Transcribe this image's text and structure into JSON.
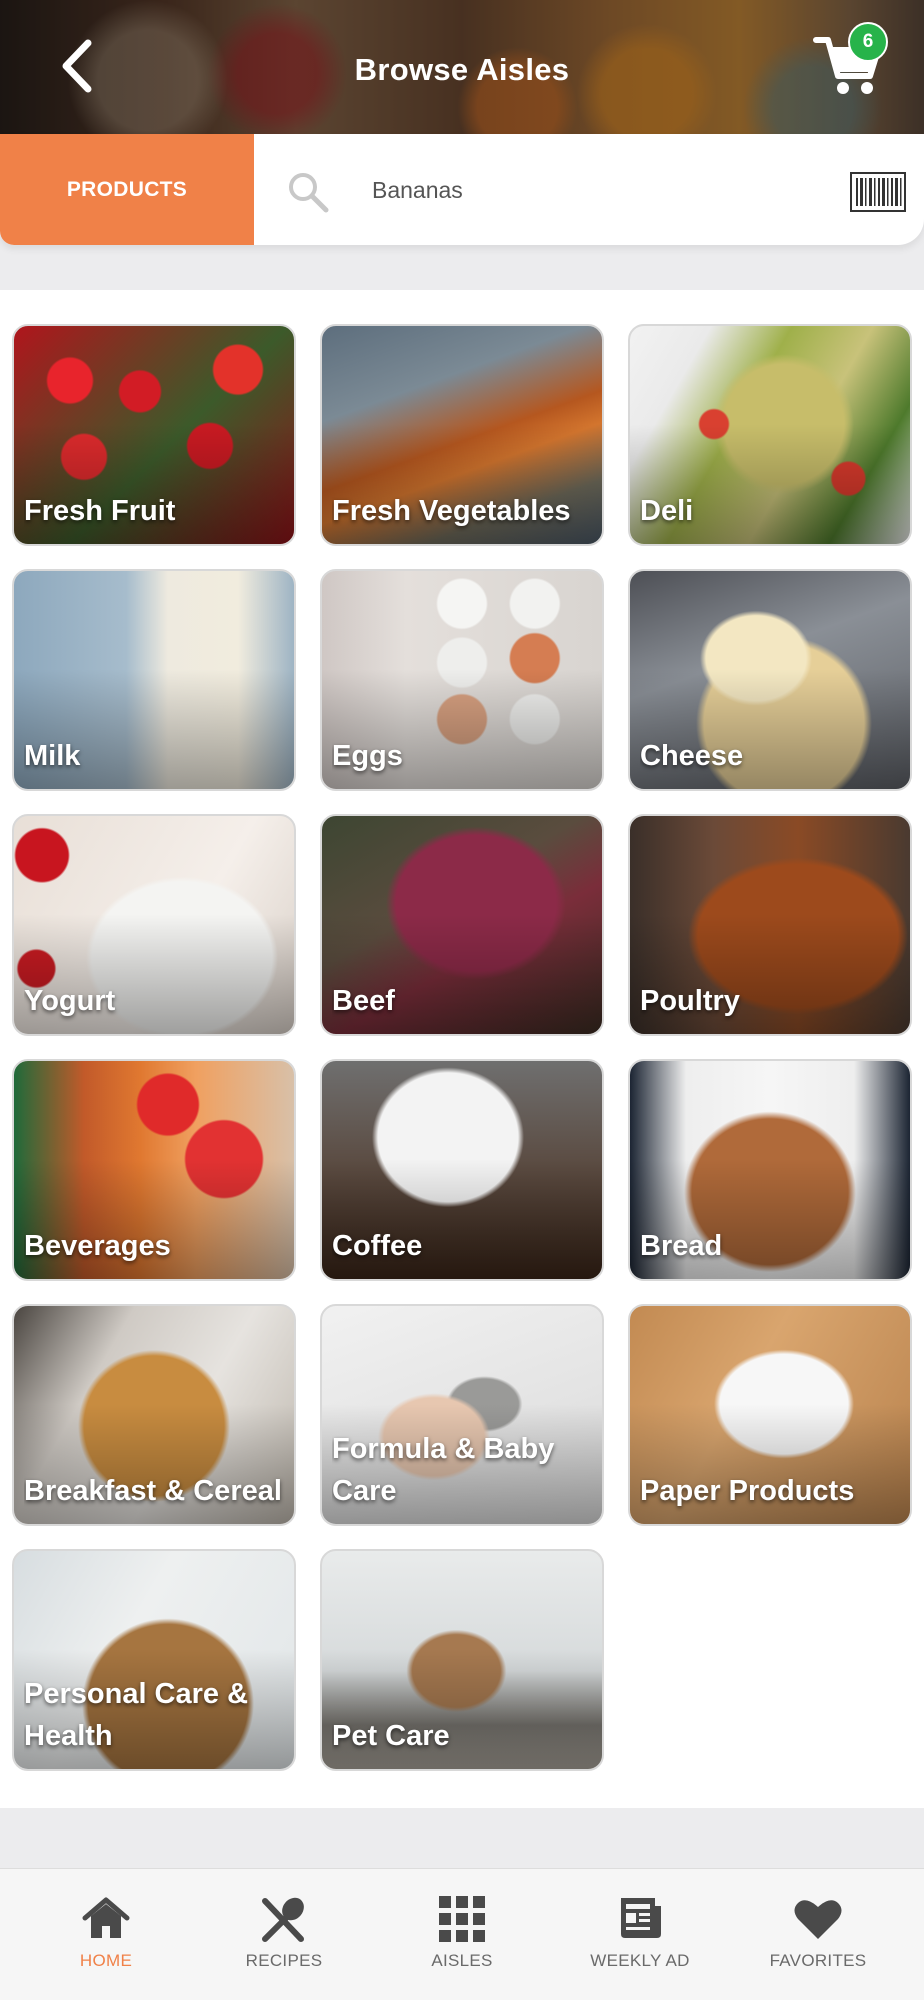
{
  "header": {
    "title": "Browse Aisles",
    "cart_count": "6"
  },
  "search": {
    "mode_label": "PRODUCTS",
    "value": "Bananas"
  },
  "aisles": [
    {
      "label": "Fresh Fruit"
    },
    {
      "label": "Fresh Vegetables"
    },
    {
      "label": "Deli"
    },
    {
      "label": "Milk"
    },
    {
      "label": "Eggs"
    },
    {
      "label": "Cheese"
    },
    {
      "label": "Yogurt"
    },
    {
      "label": "Beef"
    },
    {
      "label": "Poultry"
    },
    {
      "label": "Beverages"
    },
    {
      "label": "Coffee"
    },
    {
      "label": "Bread"
    },
    {
      "label": "Breakfast & Cereal"
    },
    {
      "label": "Formula & Baby Care"
    },
    {
      "label": "Paper Products"
    },
    {
      "label": "Personal Care & Health"
    },
    {
      "label": "Pet Care"
    }
  ],
  "nav": {
    "items": [
      {
        "label": "HOME",
        "icon": "home-icon",
        "active": true
      },
      {
        "label": "RECIPES",
        "icon": "utensils-icon",
        "active": false
      },
      {
        "label": "AISLES",
        "icon": "grid-icon",
        "active": false
      },
      {
        "label": "WEEKLY AD",
        "icon": "newspaper-icon",
        "active": false
      },
      {
        "label": "FAVORITES",
        "icon": "heart-icon",
        "active": false
      }
    ]
  },
  "colors": {
    "accent": "#f08148",
    "badge": "#27b34a",
    "nav_icon": "#4a4a4a"
  }
}
